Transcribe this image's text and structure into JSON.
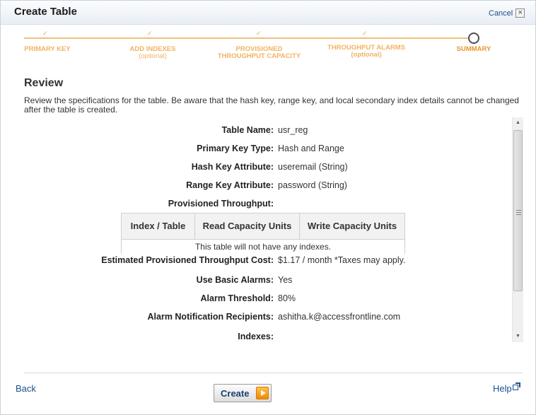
{
  "dialog": {
    "title": "Create Table",
    "cancel_label": "Cancel",
    "close_icon": "×"
  },
  "wizard": {
    "steps": [
      {
        "label": "PRIMARY KEY",
        "sub": "",
        "state": "done"
      },
      {
        "label": "ADD INDEXES",
        "sub": "(optional)",
        "state": "done"
      },
      {
        "label": "PROVISIONED",
        "sub": "THROUGHPUT CAPACITY",
        "state": "done"
      },
      {
        "label": "THROUGHPUT ALARMS",
        "sub": "(optional)",
        "state": "done"
      },
      {
        "label": "SUMMARY",
        "sub": "",
        "state": "current"
      }
    ],
    "check_glyph": "✓"
  },
  "review": {
    "heading": "Review",
    "description": "Review the specifications for the table. Be aware that the hash key, range key, and local secondary index details cannot be changed after the table is created."
  },
  "summary": {
    "table_name_label": "Table Name:",
    "table_name_value": "usr_reg",
    "primary_key_type_label": "Primary Key Type:",
    "primary_key_type_value": "Hash and Range",
    "hash_key_label": "Hash Key Attribute:",
    "hash_key_value": "useremail (String)",
    "range_key_label": "Range Key Attribute:",
    "range_key_value": "password (String)",
    "throughput_label": "Provisioned Throughput:",
    "throughput_table": {
      "headers": [
        "Index / Table",
        "Read Capacity Units",
        "Write Capacity Units"
      ],
      "empty_message": "This table will not have any indexes."
    },
    "cost_label": "Estimated Provisioned Throughput Cost:",
    "cost_value": "$1.17 / month *Taxes may apply.",
    "basic_alarms_label": "Use Basic Alarms:",
    "basic_alarms_value": "Yes",
    "alarm_threshold_label": "Alarm Threshold:",
    "alarm_threshold_value": "80%",
    "alarm_recipients_label": "Alarm Notification Recipients:",
    "alarm_recipients_value": "ashitha.k@accessfrontline.com",
    "indexes_label": "Indexes:"
  },
  "footer": {
    "back_label": "Back",
    "create_label": "Create",
    "help_label": "Help"
  },
  "colors": {
    "link": "#1a4f8e",
    "wizard_accent": "#f2b260",
    "create_arrow": "#f28a00"
  }
}
